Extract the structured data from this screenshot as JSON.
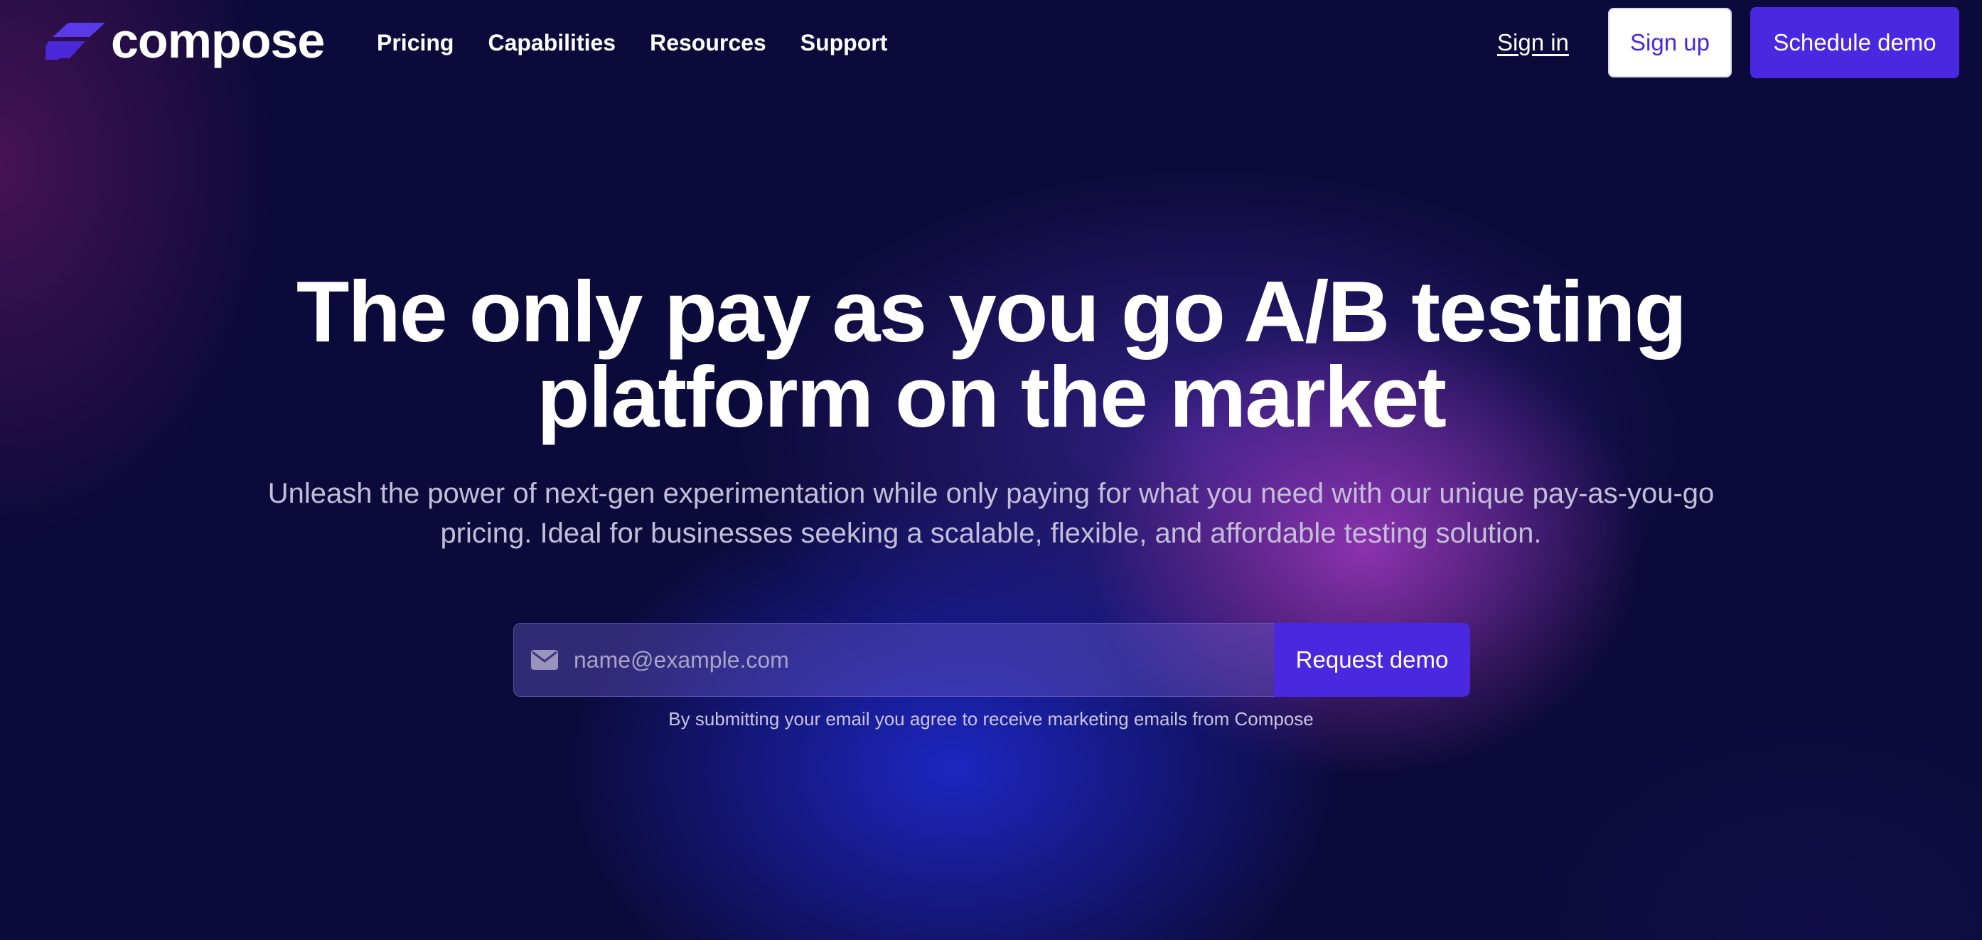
{
  "brand": {
    "name": "compose",
    "logo_icon": "compose-logo-mark",
    "accent_color": "#4a28e0"
  },
  "nav": {
    "links": [
      {
        "label": "Pricing"
      },
      {
        "label": "Capabilities"
      },
      {
        "label": "Resources"
      },
      {
        "label": "Support"
      }
    ],
    "sign_in": "Sign in",
    "sign_up": "Sign up",
    "schedule_demo": "Schedule demo"
  },
  "hero": {
    "title_line1": "The only pay as you go A/B testing",
    "title_line2": "platform on the market",
    "subtitle": "Unleash the power of next-gen experimentation while only paying for what you need with our unique pay-as-you-go pricing. Ideal for businesses seeking a scalable, flexible, and affordable testing solution."
  },
  "form": {
    "email_placeholder": "name@example.com",
    "email_value": "",
    "email_icon": "envelope-icon",
    "submit_label": "Request demo",
    "disclaimer": "By submitting your email you agree to receive marketing emails from Compose"
  }
}
